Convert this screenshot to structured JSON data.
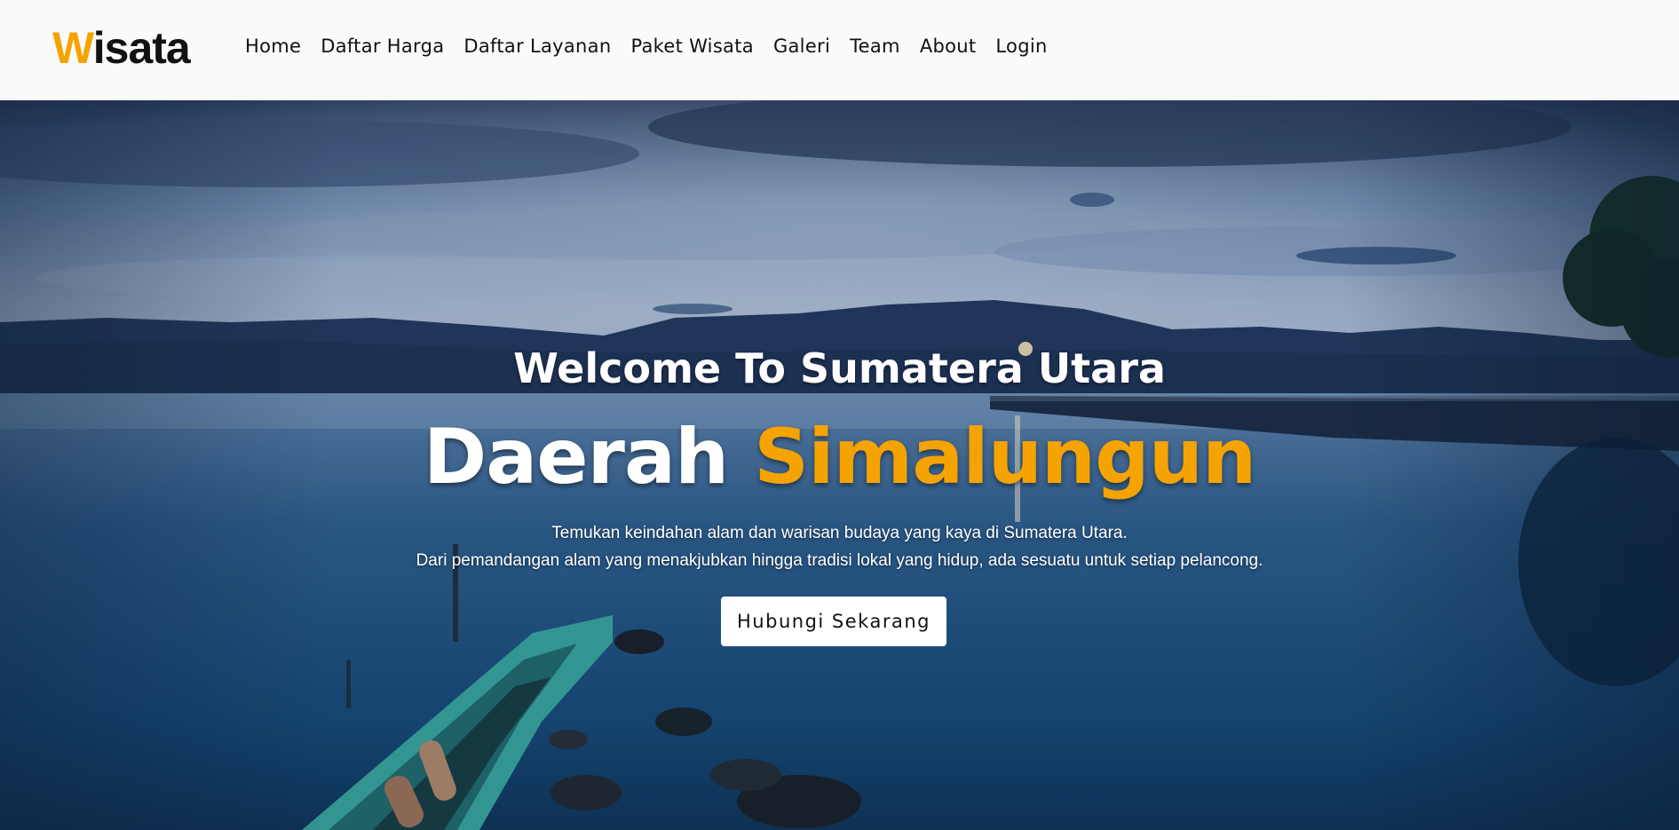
{
  "logo": {
    "accent": "W",
    "rest": "isata"
  },
  "nav": {
    "items": [
      {
        "label": "Home"
      },
      {
        "label": "Daftar Harga"
      },
      {
        "label": "Daftar Layanan"
      },
      {
        "label": "Paket Wisata"
      },
      {
        "label": "Galeri"
      },
      {
        "label": "Team"
      },
      {
        "label": "About"
      },
      {
        "label": "Login"
      }
    ]
  },
  "hero": {
    "welcome": "Welcome To Sumatera Utara",
    "title_plain": "Daerah ",
    "title_highlight": "Simalungun",
    "desc_line1": "Temukan keindahan alam dan warisan budaya yang kaya di Sumatera Utara.",
    "desc_line2": "Dari pemandangan alam yang menakjubkan hingga tradisi lokal yang hidup, ada sesuatu untuk setiap pelancong.",
    "button": "Hubungi Sekarang"
  },
  "colors": {
    "accent": "#f5a300",
    "navbar_bg": "#fafafa",
    "text_dark": "#111111"
  }
}
